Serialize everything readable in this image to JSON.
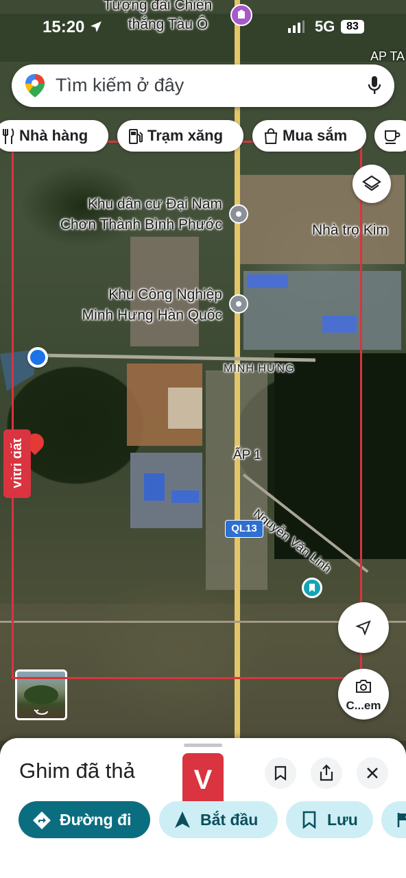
{
  "status_bar": {
    "time": "15:20",
    "network": "5G",
    "battery": "83"
  },
  "map_top_place": {
    "line1": "Tượng đài Chiến",
    "line2": "thắng Tàu Ô",
    "corner": "AP TA"
  },
  "search": {
    "placeholder": "Tìm kiếm ở đây"
  },
  "chips": [
    {
      "label": "Nhà hàng",
      "icon": "fork-knife-icon"
    },
    {
      "label": "Trạm xăng",
      "icon": "gas-station-icon"
    },
    {
      "label": "Mua sắm",
      "icon": "shopping-bag-icon"
    }
  ],
  "map_labels": {
    "place1_line1": "Khu dân cư Đại Nam",
    "place1_line2": "Chơn Thành Bình Phước",
    "place2": "Nhà trọ Kim",
    "place3_line1": "Khu Công Nghiệp",
    "place3_line2": "Minh Hưng Hàn Quốc",
    "area1": "MINH HƯNG",
    "area2": "ẤP 1",
    "road1": "Nguyễn Văn Linh",
    "highway": "QL13",
    "dropped_pin": "Vitri đất"
  },
  "camera_button": {
    "label": "C...em"
  },
  "sheet": {
    "title": "Ghim đã thả",
    "overlay_logo": "V",
    "buttons": [
      {
        "label": "Đường đi",
        "icon": "directions-icon"
      },
      {
        "label": "Bắt đầu",
        "icon": "navigation-arrow-icon"
      },
      {
        "label": "Lưu",
        "icon": "bookmark-icon"
      }
    ]
  },
  "colors": {
    "accent_teal": "#0b6e80",
    "chip_light": "#cdeef5",
    "frame_red": "#d9343f",
    "pin_red": "#e53935",
    "logo_red": "#d9343f"
  }
}
